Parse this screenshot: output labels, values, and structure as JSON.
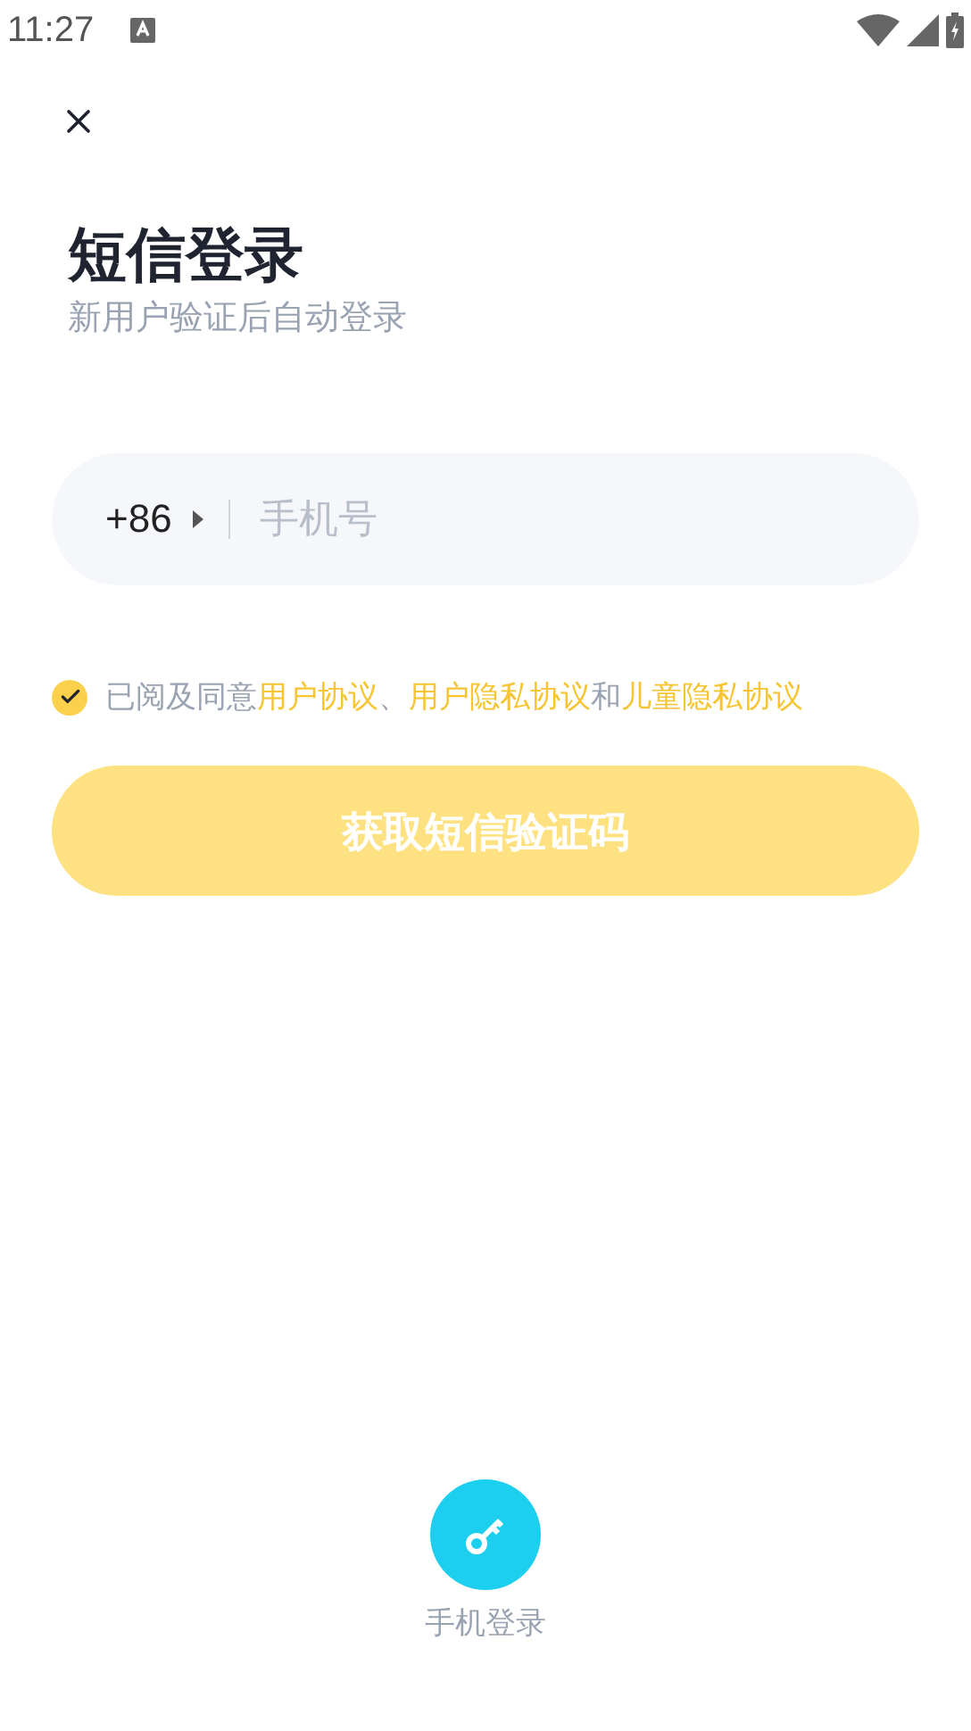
{
  "status_bar": {
    "time": "11:27"
  },
  "title": "短信登录",
  "subtitle": "新用户验证后自动登录",
  "phone_field": {
    "country_code": "+86",
    "placeholder": "手机号"
  },
  "agreement": {
    "checked": true,
    "parts": [
      {
        "kind": "text",
        "text": "已阅及同意"
      },
      {
        "kind": "link",
        "text": "用户协议"
      },
      {
        "kind": "text",
        "text": "、"
      },
      {
        "kind": "link",
        "text": "用户隐私协议"
      },
      {
        "kind": "text",
        "text": "和"
      },
      {
        "kind": "link",
        "text": "儿童隐私协议"
      }
    ]
  },
  "submit_button": {
    "label": "获取短信验证码",
    "disabled": true
  },
  "alt_login": {
    "label": "手机登录"
  }
}
